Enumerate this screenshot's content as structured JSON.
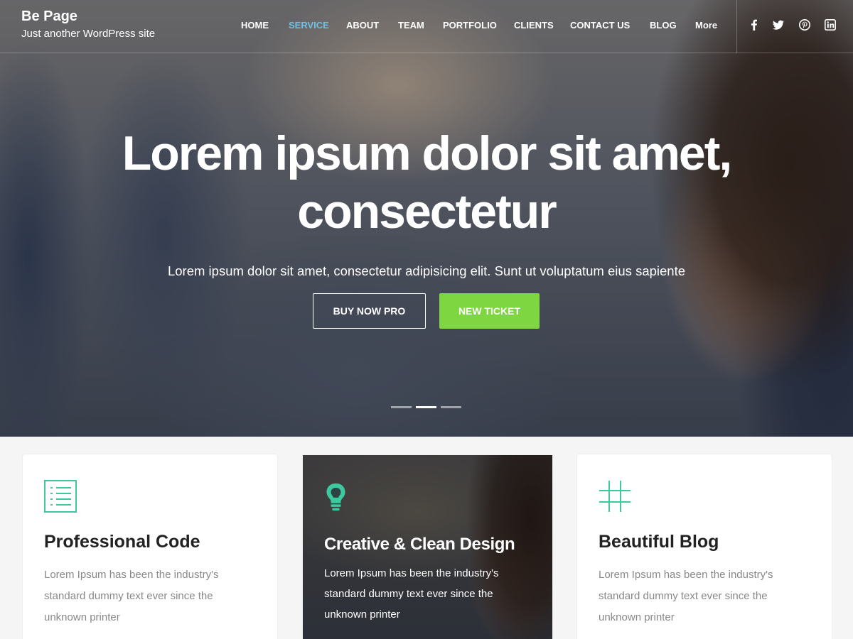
{
  "header": {
    "site_title": "Be Page",
    "tagline": "Just another WordPress site",
    "nav": [
      {
        "label": "HOME",
        "active": false
      },
      {
        "label": "SERVICE",
        "active": true
      },
      {
        "label": "ABOUT",
        "active": false
      },
      {
        "label": "TEAM",
        "active": false
      },
      {
        "label": "PORTFOLIO",
        "active": false
      },
      {
        "label": "CLIENTS",
        "active": false
      },
      {
        "label": "CONTACT US",
        "active": false
      },
      {
        "label": "BLOG",
        "active": false
      },
      {
        "label": "More",
        "active": false
      }
    ],
    "social": [
      "facebook-icon",
      "twitter-icon",
      "pinterest-icon",
      "linkedin-icon"
    ]
  },
  "hero": {
    "title_line1": "Lorem ipsum dolor sit amet,",
    "title_line2": "consectetur",
    "subtitle": "Lorem ipsum dolor sit amet, consectetur adipisicing elit. Sunt ut voluptatum eius sapiente",
    "button_primary": "BUY NOW PRO",
    "button_secondary": "NEW TICKET",
    "slides_count": 3,
    "active_slide": 2
  },
  "features": [
    {
      "icon": "list-icon",
      "title": "Professional Code",
      "text": "Lorem Ipsum has been the industry's standard dummy text ever since the unknown printer"
    },
    {
      "icon": "lightbulb-icon",
      "title": "Creative & Clean Design",
      "text": "Lorem Ipsum has been the industry's standard dummy text ever since the unknown printer"
    },
    {
      "icon": "grid-icon",
      "title": "Beautiful Blog",
      "text": "Lorem Ipsum has been the industry's standard dummy text ever since the unknown printer"
    }
  ],
  "colors": {
    "accent_teal": "#3cc9a0",
    "nav_active": "#6ec1e4",
    "button_green": "#7ed640"
  }
}
